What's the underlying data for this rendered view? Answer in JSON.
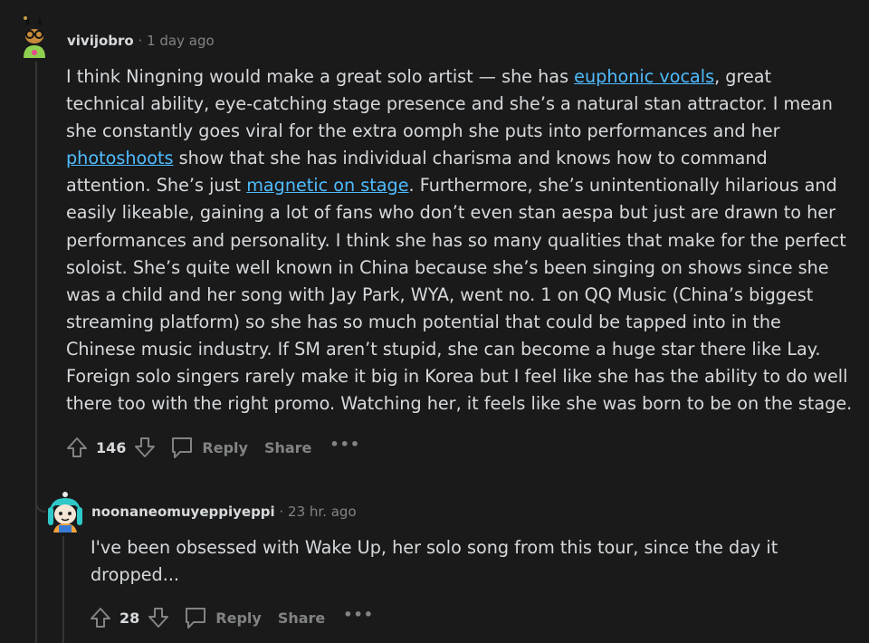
{
  "comments": [
    {
      "username": "vivijobro",
      "separator": "·",
      "time": "1 day ago",
      "body_segments": [
        {
          "text": "I think Ningning would make a great solo artist — she has ",
          "link": false
        },
        {
          "text": "euphonic vocals",
          "link": true
        },
        {
          "text": ", great technical ability, eye-catching stage presence and she’s a natural stan attractor. I mean she constantly goes viral for the extra oomph she puts into performances and her ",
          "link": false
        },
        {
          "text": "photoshoots",
          "link": true
        },
        {
          "text": " show that she has individual charisma and knows how to command attention. She’s just ",
          "link": false
        },
        {
          "text": "magnetic on stage",
          "link": true
        },
        {
          "text": ". Furthermore, she’s unintentionally hilarious and easily likeable, gaining a lot of fans who don’t even stan aespa but just are drawn to her performances and personality. I think she has so many qualities that make for the perfect soloist. She’s quite well known in China because she’s been singing on shows since she was a child and her song with Jay Park, WYA, went no. 1 on QQ Music (China’s biggest streaming platform) so she has so much potential that could be tapped into in the Chinese music industry. If SM aren’t stupid, she can become a huge star there like Lay. Foreign solo singers rarely make it big in Korea but I feel like she has the ability to do well there too with the right promo. Watching her, it feels like she was born to be on the stage.",
          "link": false
        }
      ],
      "score": "146",
      "reply_label": "Reply",
      "share_label": "Share",
      "more_label": "•••"
    },
    {
      "username": "noonaneomuyeppiyeppi",
      "separator": "·",
      "time": "23 hr. ago",
      "body_segments": [
        {
          "text": "I've been obsessed with Wake Up, her solo song from this tour, since the day it dropped...",
          "link": false
        }
      ],
      "score": "28",
      "reply_label": "Reply",
      "share_label": "Share",
      "more_label": "•••"
    }
  ],
  "colors": {
    "background": "#1a1a1b",
    "text": "#d7dadc",
    "muted": "#818384",
    "link": "#4fbcff",
    "thread_line": "#343536"
  }
}
